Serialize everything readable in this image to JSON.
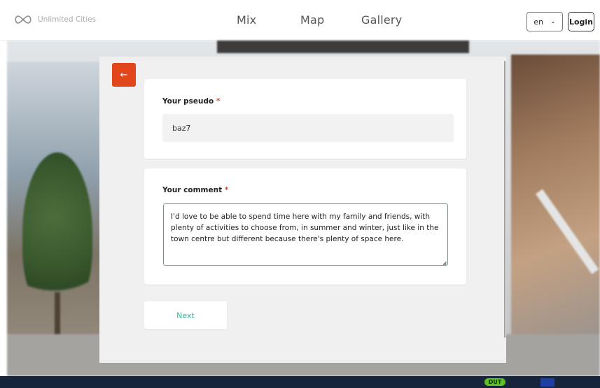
{
  "header": {
    "logo_text": "Unlimited Cities",
    "nav": [
      "Mix",
      "Map",
      "Gallery"
    ],
    "language": "en",
    "login_label": "Login"
  },
  "form": {
    "back_icon": "arrow-left-icon",
    "pseudo_label": "Your pseudo",
    "pseudo_required": "*",
    "pseudo_value": "baz7",
    "comment_label": "Your comment",
    "comment_required": "*",
    "comment_value": "I'd love to be able to spend time here with my family and friends, with plenty of activities to choose from, in summer and winter, just like in the town centre but different because there's plenty of space here.",
    "next_label": "Next"
  },
  "footer": {
    "dut_badge": "DUT"
  },
  "colors": {
    "accent": "#2fb59c",
    "back_button": "#e2471c",
    "footer": "#17253a"
  }
}
